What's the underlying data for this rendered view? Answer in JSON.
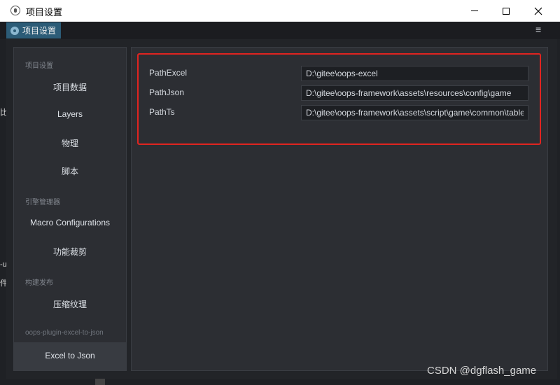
{
  "window": {
    "title": "项目设置"
  },
  "tab": {
    "label": "项目设置",
    "menu_icon": "≡"
  },
  "edge": {
    "mark1": "比",
    "mark2": "-u",
    "mark3": "件"
  },
  "sidebar": {
    "sections": [
      {
        "title": "项目设置",
        "items": [
          {
            "label": "项目数据"
          },
          {
            "label": "Layers"
          },
          {
            "label": "物理"
          },
          {
            "label": "脚本"
          }
        ]
      },
      {
        "title": "引擎管理器",
        "items": [
          {
            "label": "Macro Configurations"
          },
          {
            "label": "功能裁剪"
          }
        ]
      },
      {
        "title": "构建发布",
        "items": [
          {
            "label": "压缩纹理"
          }
        ]
      },
      {
        "title": "oops-plugin-excel-to-json",
        "items": [
          {
            "label": "Excel to Json",
            "active": true
          }
        ]
      }
    ]
  },
  "properties": [
    {
      "label": "PathExcel",
      "value": "D:\\gitee\\oops-excel"
    },
    {
      "label": "PathJson",
      "value": "D:\\gitee\\oops-framework\\assets\\resources\\config\\game"
    },
    {
      "label": "PathTs",
      "value": "D:\\gitee\\oops-framework\\assets\\script\\game\\common\\table"
    }
  ],
  "highlight_color": "#e02420",
  "accent_color": "#2c5c77",
  "watermark": "CSDN @dgflash_game"
}
